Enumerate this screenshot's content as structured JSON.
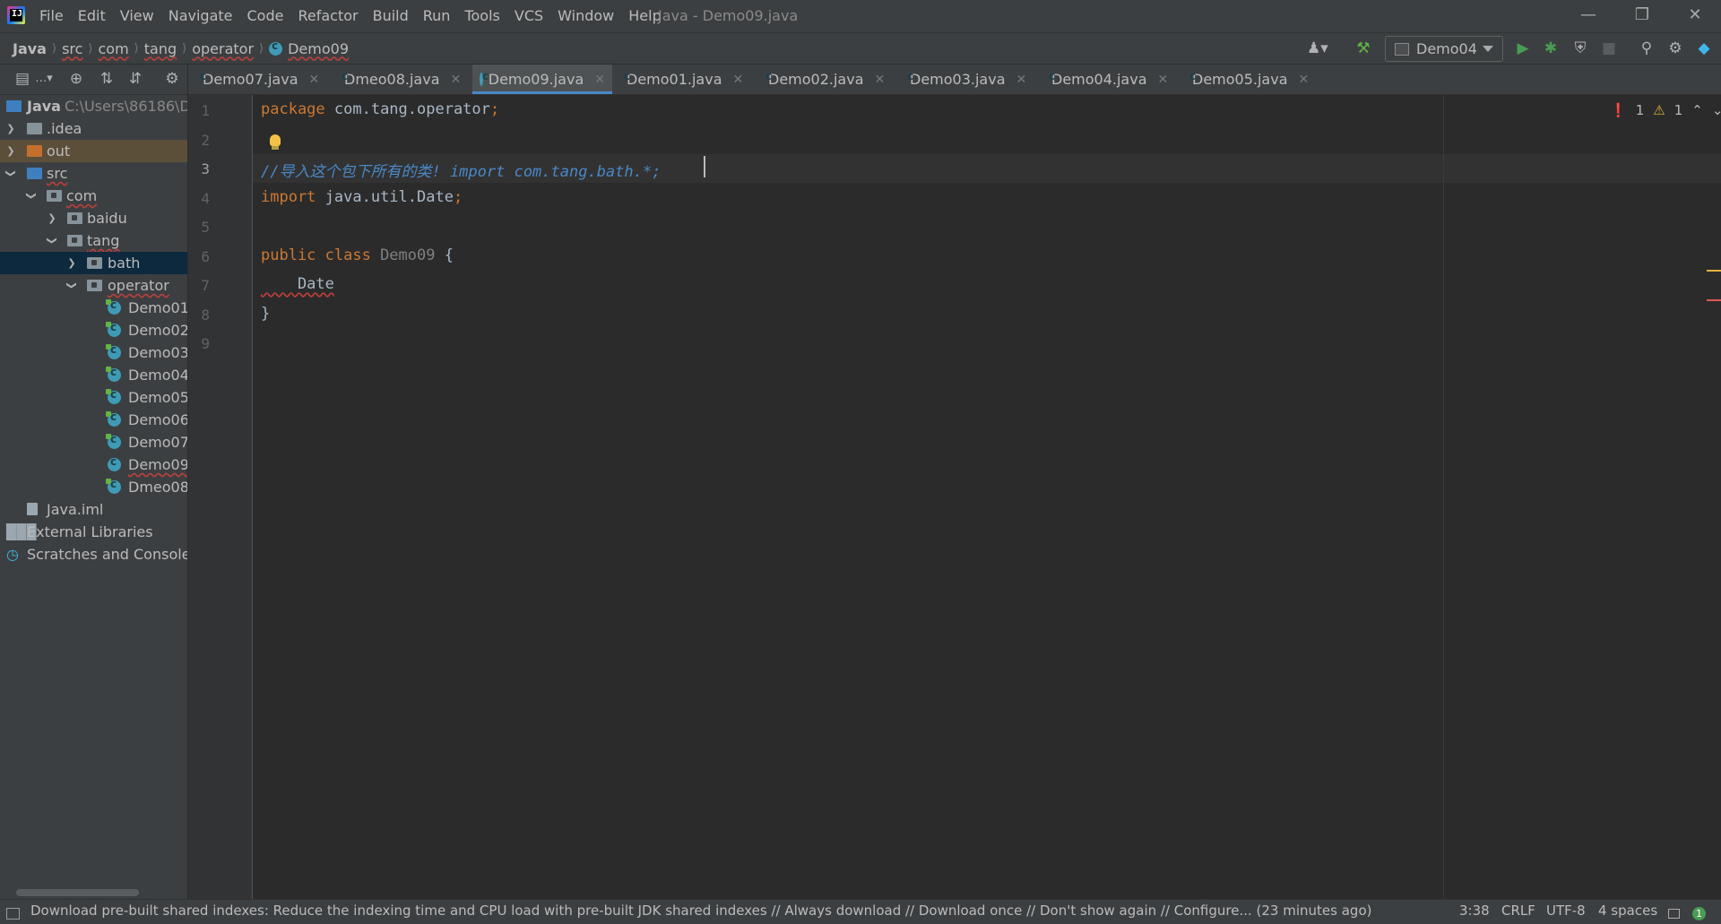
{
  "app": {
    "logo_text": "IJ",
    "window_title": "Java - Demo09.java",
    "menu": [
      "File",
      "Edit",
      "View",
      "Navigate",
      "Code",
      "Refactor",
      "Build",
      "Run",
      "Tools",
      "VCS",
      "Window",
      "Help"
    ]
  },
  "breadcrumb": [
    "Java",
    "src",
    "com",
    "tang",
    "operator",
    "Demo09"
  ],
  "toolbar": {
    "run_config": "Demo04",
    "icons": [
      "user-icon",
      "build-hammer-icon",
      "run-icon",
      "debug-icon",
      "coverage-icon",
      "stop-icon",
      "search-icon",
      "settings-icon",
      "jetbrains-space-icon"
    ]
  },
  "tabs": [
    {
      "label": "Demo07.java",
      "active": false
    },
    {
      "label": "Dmeo08.java",
      "active": false
    },
    {
      "label": "Demo09.java",
      "active": true
    },
    {
      "label": "Demo01.java",
      "active": false
    },
    {
      "label": "Demo02.java",
      "active": false
    },
    {
      "label": "Demo03.java",
      "active": false
    },
    {
      "label": "Demo04.java",
      "active": false
    },
    {
      "label": "Demo05.java",
      "active": false
    }
  ],
  "project_tree": {
    "root": {
      "label": "Java",
      "path": "C:\\Users\\86186\\De"
    },
    "items": [
      ".idea",
      "out",
      "src",
      "com",
      "baidu",
      "tang",
      "bath",
      "operator",
      "Demo01",
      "Demo02",
      "Demo03",
      "Demo04",
      "Demo05",
      "Demo06",
      "Demo07",
      "Demo09",
      "Dmeo08",
      "Java.iml",
      "External Libraries",
      "Scratches and Consoles"
    ]
  },
  "editor": {
    "line_numbers": [
      "1",
      "2",
      "3",
      "4",
      "5",
      "6",
      "7",
      "8",
      "9"
    ],
    "current_line": 3,
    "code": {
      "l1_kw": "package",
      "l1_rest": " com.tang.operator",
      "l1_semi": ";",
      "l3_comment": "//导入这个包下所有的类! import com.tang.bath.*;",
      "l4_kw": "import",
      "l4_rest": " java.util.Date",
      "l4_semi": ";",
      "l6_kw": "public class",
      "l6_name": " Demo09",
      "l6_brace": " {",
      "l7": "    Date",
      "l8": "}"
    },
    "inspections": {
      "errors": "1",
      "warnings": "1"
    }
  },
  "status": {
    "message": "Download pre-built shared indexes: Reduce the indexing time and CPU load with pre-built JDK shared indexes // Always download // Download once // Don't show again // Configure... (23 minutes ago)",
    "position": "3:38",
    "line_sep": "CRLF",
    "encoding": "UTF-8",
    "indent": "4 spaces",
    "event_count": "1"
  },
  "colors": {
    "accent": "#4a88c7",
    "keyword": "#cc7832",
    "comment": "#4a88c7",
    "error": "#e05555",
    "warning": "#e6b43b"
  }
}
